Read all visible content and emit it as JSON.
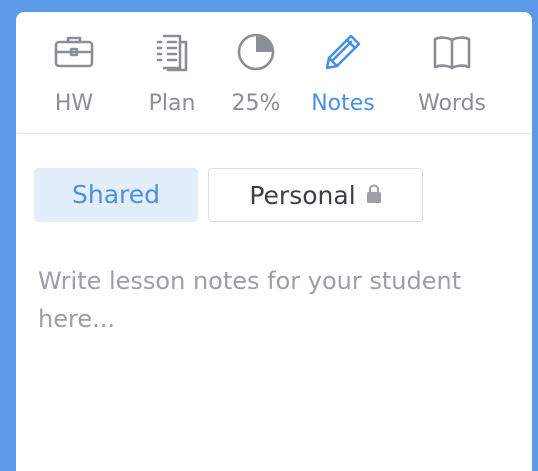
{
  "tabs": [
    {
      "label": "HW",
      "icon": "briefcase-icon",
      "active": false
    },
    {
      "label": "Plan",
      "icon": "document-list-icon",
      "active": false
    },
    {
      "label": "25%",
      "icon": "progress-pie-icon",
      "active": false,
      "progress": 0.25
    },
    {
      "label": "Notes",
      "icon": "pencil-icon",
      "active": true
    },
    {
      "label": "Words",
      "icon": "book-icon",
      "active": false
    }
  ],
  "notes": {
    "toggles": {
      "shared_label": "Shared",
      "personal_label": "Personal",
      "selected": "Shared"
    },
    "editor": {
      "value": "",
      "placeholder": "Write lesson notes for your student here..."
    }
  },
  "colors": {
    "background": "#5b9ae6",
    "accent": "#4a90e2",
    "icon_gray": "#8a8f96",
    "shared_bg": "#e3eefb"
  }
}
